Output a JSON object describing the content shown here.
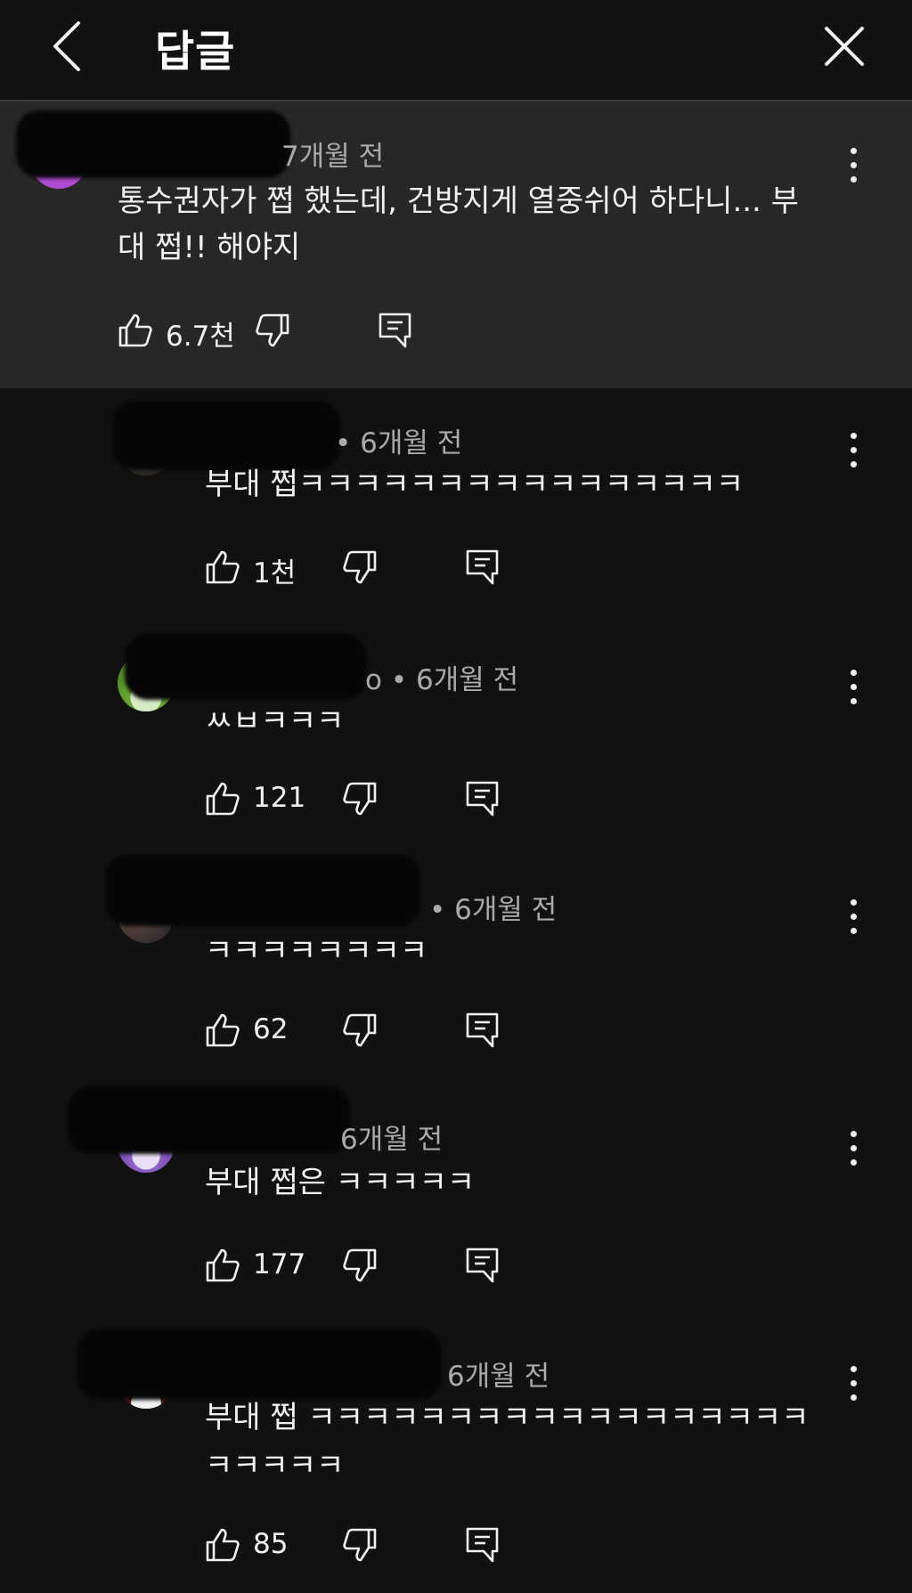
{
  "header": {
    "title": "답글"
  },
  "icons": {
    "back": "chevron-left-icon",
    "close": "close-icon",
    "like": "thumbs-up-icon",
    "dislike": "thumbs-down-icon",
    "reply": "comment-icon",
    "more": "vertical-dots-icon"
  },
  "colors": {
    "background": "#111111",
    "highlight_background": "#272727",
    "text_primary": "#f1f1f1",
    "text_secondary": "#aaaaaa"
  },
  "top_comment": {
    "meta": "7개월 전",
    "text_line1": "통수권자가 쩝 했는데, 건방지게 열중쉬어 하다니...  부",
    "text_line2": "대 쩝!! 해야지",
    "likes": "6.7천"
  },
  "replies": [
    {
      "meta": "• 6개월 전",
      "text_line1": "부대 쩝ㅋㅋㅋㅋㅋㅋㅋㅋㅋㅋㅋㅋㅋㅋㅋㅋ",
      "text_line2": "",
      "likes": "1천"
    },
    {
      "meta": "o • 6개월 전",
      "text_line1": "ㅆㅂㅋㅋㅋ",
      "text_line2": "",
      "likes": "121"
    },
    {
      "meta": "• 6개월 전",
      "text_line1": "ㅋㅋㅋㅋㅋㅋㅋㅋ",
      "text_line2": "",
      "likes": "62"
    },
    {
      "meta": "6개월 전",
      "text_line1": "부대 쩝은 ㅋㅋㅋㅋㅋ",
      "text_line2": "",
      "likes": "177"
    },
    {
      "meta": "6개월 전",
      "text_line1": "부대 쩝 ㅋㅋㅋㅋㅋㅋㅋㅋㅋㅋㅋㅋㅋㅋㅋㅋㅋㅋ",
      "text_line2": "ㅋㅋㅋㅋㅋ",
      "likes": "85"
    }
  ]
}
